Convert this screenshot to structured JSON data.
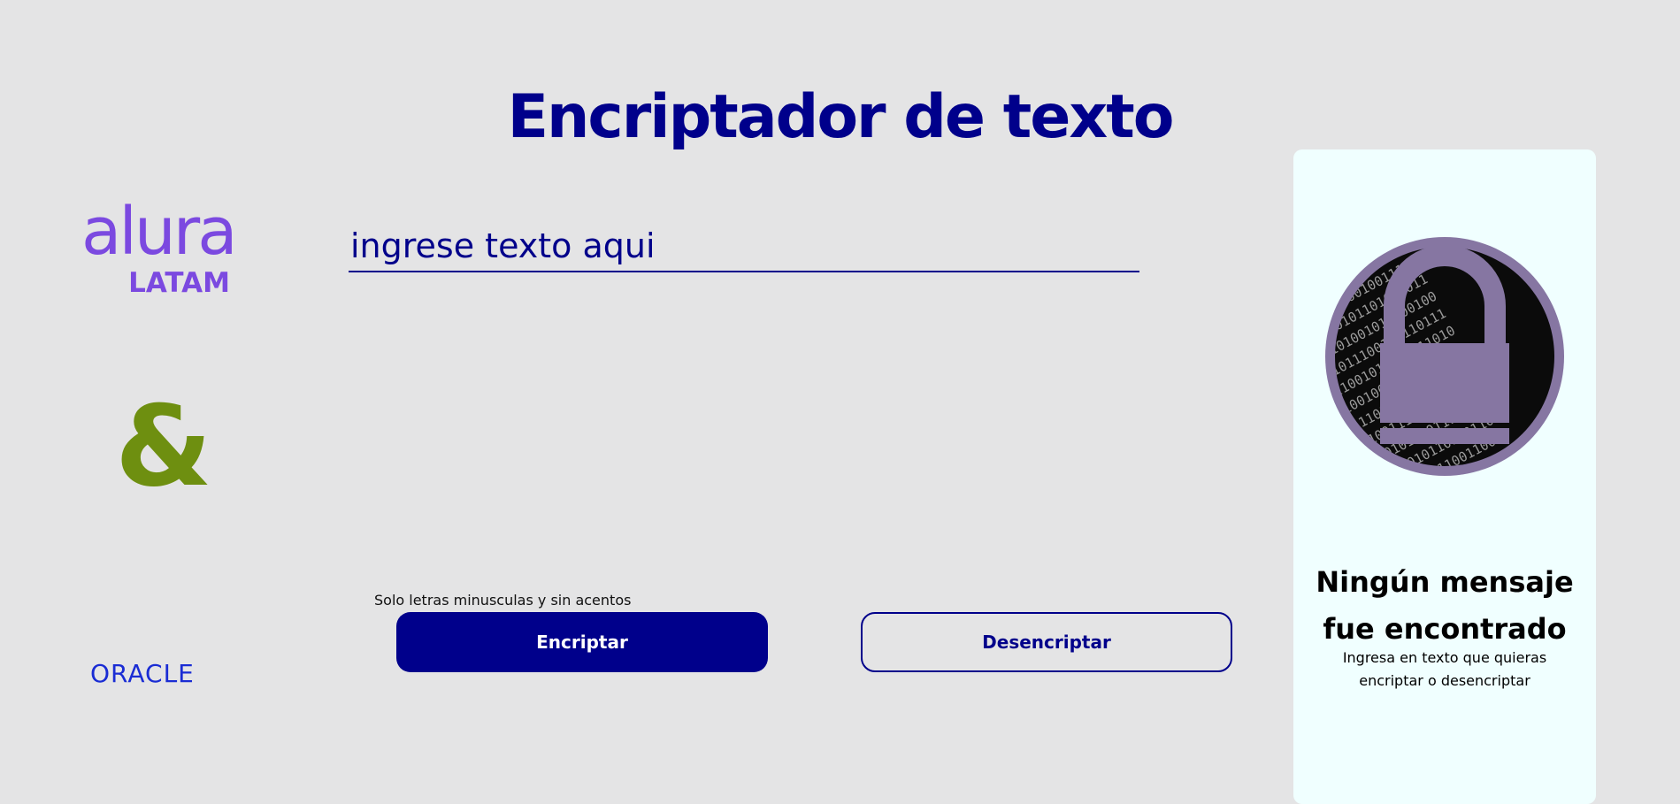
{
  "header": {
    "title": "Encriptador de texto"
  },
  "logos": {
    "alura_word": "alura",
    "alura_sub": "LATAM",
    "ampersand": "&",
    "oracle": "ORACLE"
  },
  "input": {
    "placeholder": "ingrese texto aqui",
    "value": ""
  },
  "hint": "Solo letras minusculas y sin acentos",
  "buttons": {
    "encrypt_label": "Encriptar",
    "decrypt_label": "Desencriptar"
  },
  "result_panel": {
    "title": "Ningún mensaje fue encontrado",
    "description": "Ingresa en texto que quieras encriptar o desencriptar",
    "illustration": "padlock-binary-icon"
  },
  "colors": {
    "background": "#e4e4e5",
    "primary": "#00008b",
    "panel": "#f0ffff",
    "alura": "#7b49e0",
    "oracle": "#1a2cd4",
    "ampersand": "#6e8f10",
    "lock": "#8676a2"
  }
}
